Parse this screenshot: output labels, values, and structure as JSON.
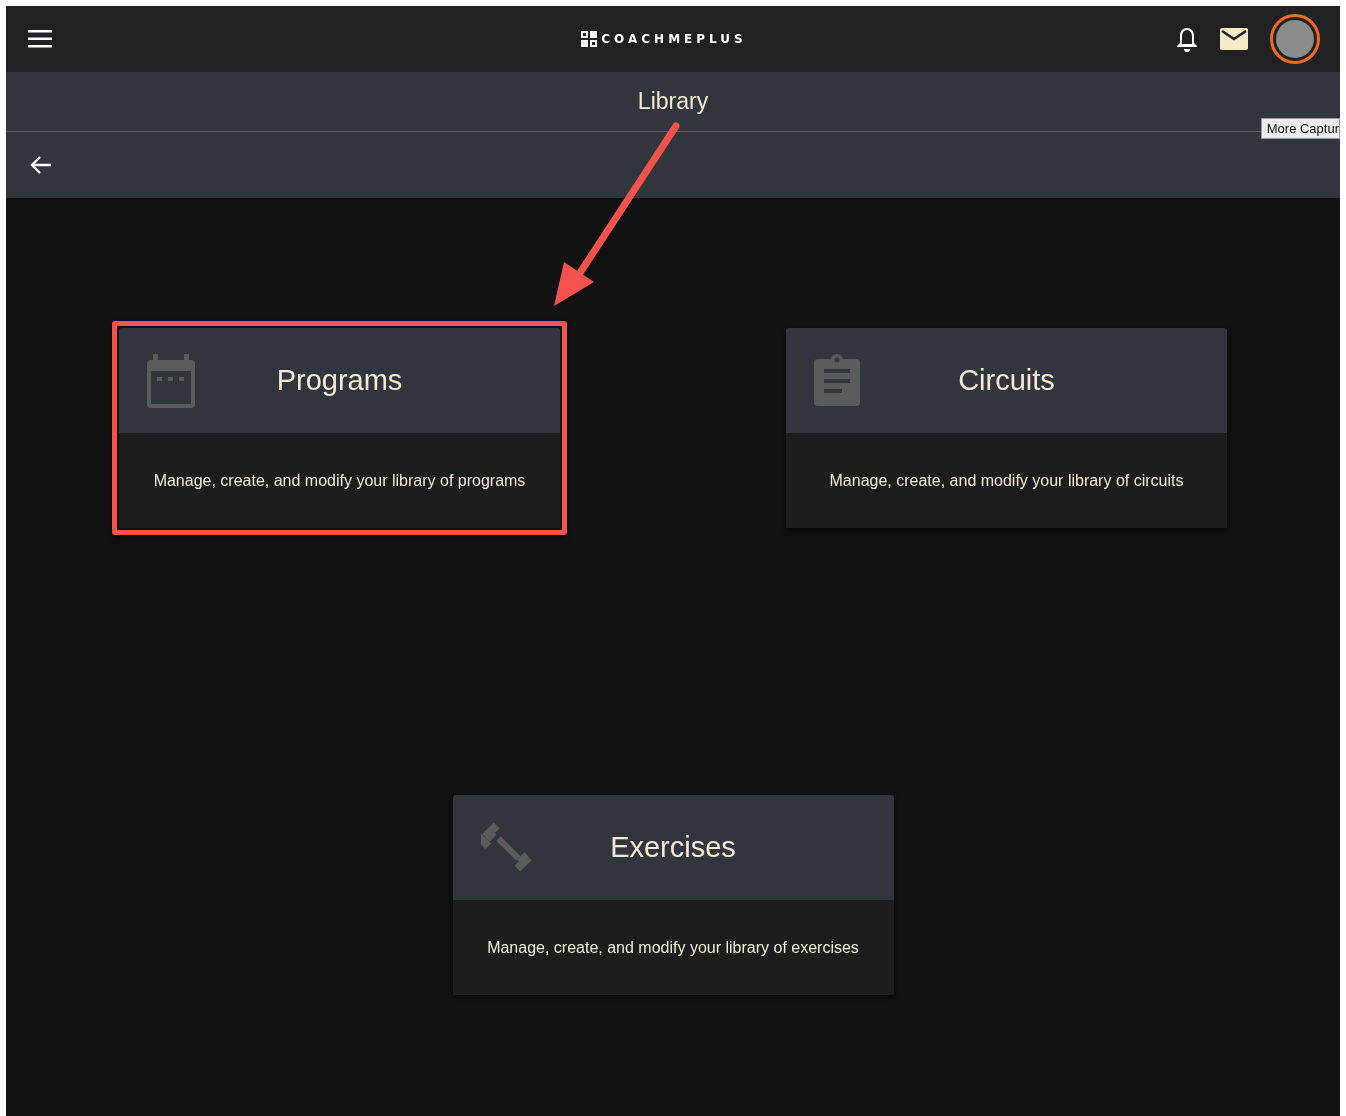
{
  "header": {
    "logo_text": "COACHMEPLUS"
  },
  "page_title": "Library",
  "tooltip": "More Captur",
  "cards": [
    {
      "kind": "calendar",
      "title": "Programs",
      "description": "Manage, create, and modify your library of programs",
      "highlighted": true
    },
    {
      "kind": "clipboard",
      "title": "Circuits",
      "description": "Manage, create, and modify your library of circuits",
      "highlighted": false
    },
    {
      "kind": "dumbbell",
      "title": "Exercises",
      "description": "Manage, create, and modify your library of exercises",
      "highlighted": false
    }
  ]
}
